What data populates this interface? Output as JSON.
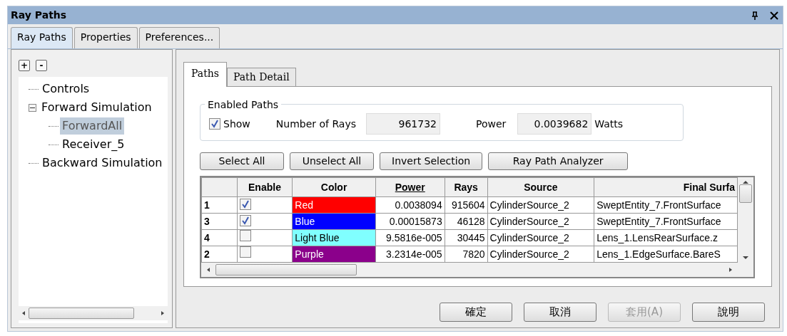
{
  "window": {
    "title": "Ray Paths"
  },
  "tabs": [
    {
      "label": "Ray Paths",
      "selected": true
    },
    {
      "label": "Properties",
      "selected": false
    },
    {
      "label": "Preferences...",
      "selected": false
    }
  ],
  "tree": {
    "expand_all": "+",
    "collapse_all": "-",
    "items": [
      {
        "label": "Controls",
        "selected": false
      },
      {
        "label": "Forward Simulation",
        "selected": false,
        "expanded": true,
        "children": [
          {
            "label": "ForwardAll",
            "selected": true
          },
          {
            "label": "Receiver_5",
            "selected": false
          }
        ]
      },
      {
        "label": "Backward Simulation",
        "selected": false
      }
    ]
  },
  "inner_tabs": [
    {
      "label": "Paths",
      "selected": true
    },
    {
      "label": "Path Detail",
      "selected": false
    }
  ],
  "enabled_paths": {
    "title": "Enabled Paths",
    "show": {
      "label": "Show",
      "checked": true
    },
    "rays_label": "Number of Rays",
    "rays_value": "961732",
    "power_label": "Power",
    "power_value": "0.0039682",
    "power_unit": "Watts"
  },
  "actions": [
    "Select All",
    "Unselect All",
    "Invert Selection",
    "Ray Path Analyzer"
  ],
  "table": {
    "columns": [
      "",
      "Enable",
      "Color",
      "Power",
      "Rays",
      "Source",
      "Final Surfa"
    ],
    "rows": [
      {
        "id": "1",
        "enabled": true,
        "color_name": "Red",
        "color": "#ff0000",
        "power": "0.0038094",
        "rays": "915604",
        "source": "CylinderSource_2",
        "final": "SweptEntity_7.FrontSurface"
      },
      {
        "id": "3",
        "enabled": true,
        "color_name": "Blue",
        "color": "#0000ff",
        "power": "0.00015873",
        "rays": "46128",
        "source": "CylinderSource_2",
        "final": "SweptEntity_7.FrontSurface"
      },
      {
        "id": "4",
        "enabled": false,
        "color_name": "Light Blue",
        "color": "#80ffff",
        "power": "9.5816e-005",
        "rays": "30445",
        "source": "CylinderSource_2",
        "final": "Lens_1.LensRearSurface.z"
      },
      {
        "id": "2",
        "enabled": false,
        "color_name": "Purple",
        "color": "#8b008b",
        "power": "3.2314e-005",
        "rays": "7820",
        "source": "CylinderSource_2",
        "final": "Lens_1.EdgeSurface.BareS"
      }
    ]
  },
  "dialog_buttons": [
    {
      "label": "確定",
      "disabled": false
    },
    {
      "label": "取消",
      "disabled": false
    },
    {
      "label": "套用(A)",
      "disabled": true
    },
    {
      "label": "說明",
      "disabled": false
    }
  ]
}
